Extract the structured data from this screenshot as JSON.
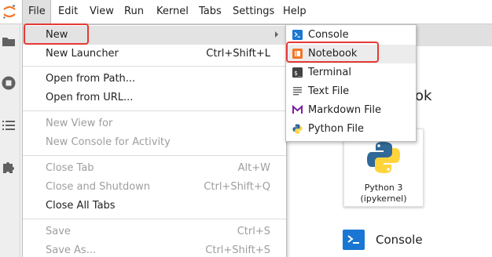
{
  "menubar": {
    "items": [
      "File",
      "Edit",
      "View",
      "Run",
      "Kernel",
      "Tabs",
      "Settings",
      "Help"
    ]
  },
  "file_menu": {
    "items": [
      {
        "label": "New",
        "shortcut": "",
        "disabled": false,
        "submenu": true
      },
      {
        "label": "New Launcher",
        "shortcut": "Ctrl+Shift+L",
        "disabled": false
      },
      {
        "label": "Open from Path...",
        "shortcut": "",
        "disabled": false
      },
      {
        "label": "Open from URL...",
        "shortcut": "",
        "disabled": false
      },
      {
        "label": "New View for",
        "shortcut": "",
        "disabled": true
      },
      {
        "label": "New Console for Activity",
        "shortcut": "",
        "disabled": true
      },
      {
        "label": "Close Tab",
        "shortcut": "Alt+W",
        "disabled": true
      },
      {
        "label": "Close and Shutdown",
        "shortcut": "Ctrl+Shift+Q",
        "disabled": true
      },
      {
        "label": "Close All Tabs",
        "shortcut": "",
        "disabled": false
      },
      {
        "label": "Save",
        "shortcut": "Ctrl+S",
        "disabled": true
      },
      {
        "label": "Save As...",
        "shortcut": "Ctrl+Shift+S",
        "disabled": true
      }
    ]
  },
  "new_submenu": {
    "items": [
      {
        "label": "Console",
        "icon": "console-icon"
      },
      {
        "label": "Notebook",
        "icon": "notebook-icon"
      },
      {
        "label": "Terminal",
        "icon": "terminal-icon"
      },
      {
        "label": "Text File",
        "icon": "text-file-icon"
      },
      {
        "label": "Markdown File",
        "icon": "markdown-icon"
      },
      {
        "label": "Python File",
        "icon": "python-icon"
      }
    ]
  },
  "launcher": {
    "heading_fragment": "ook",
    "kernel_card": {
      "line1": "Python 3",
      "line2": "(ipykernel)"
    },
    "console_label": "Console"
  },
  "colors": {
    "highlight": "#e53935",
    "console_blue": "#1976d2",
    "notebook_orange": "#f37626",
    "markdown_purple": "#7b1fa2",
    "python_blue": "#306998",
    "python_yellow": "#ffd43b"
  }
}
